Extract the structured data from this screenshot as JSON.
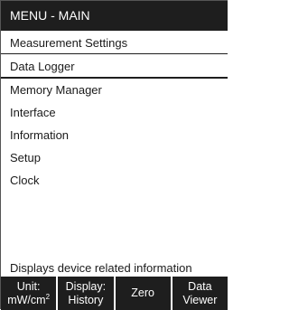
{
  "header": {
    "title": "MENU - MAIN"
  },
  "menu": {
    "items": [
      {
        "label": "Measurement Settings"
      },
      {
        "label": "Data Logger"
      },
      {
        "label": "Memory Manager"
      },
      {
        "label": "Interface"
      },
      {
        "label": "Information"
      },
      {
        "label": "Setup"
      },
      {
        "label": "Clock"
      }
    ],
    "selected_label": "Data Logger"
  },
  "status": {
    "text": "Displays device related information"
  },
  "softkeys": {
    "unit": {
      "line1": "Unit:",
      "line2": "mW/cm",
      "sup": "2"
    },
    "display": {
      "line1": "Display:",
      "line2": "History"
    },
    "zero": {
      "label": "Zero"
    },
    "data_viewer": {
      "line1": "Data",
      "line2": "Viewer"
    }
  },
  "colors": {
    "bar": "#1e1e1e",
    "text": "#1a1a1a",
    "background": "#ffffff"
  }
}
